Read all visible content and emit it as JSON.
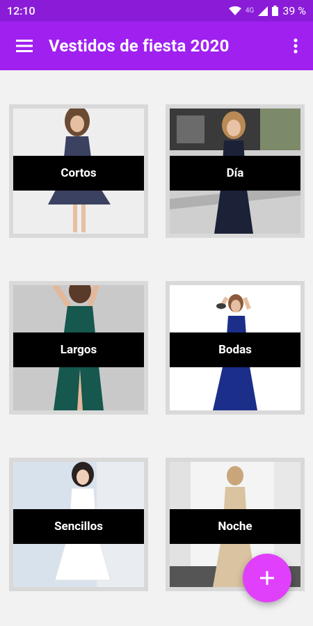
{
  "status_bar": {
    "time": "12:10",
    "network": "4G",
    "battery": "39 %"
  },
  "app_bar": {
    "title": "Vestidos de fiesta 2020",
    "menu_icon": "hamburger-menu-icon",
    "more_icon": "more-vert-icon"
  },
  "categories": [
    {
      "label": "Cortos"
    },
    {
      "label": "Día"
    },
    {
      "label": "Largos"
    },
    {
      "label": "Bodas"
    },
    {
      "label": "Sencillos"
    },
    {
      "label": "Noche"
    }
  ],
  "fab": {
    "icon": "plus-icon"
  },
  "colors": {
    "status_bar": "#8a1cd8",
    "app_bar": "#a020f0",
    "fab": "#e040fb",
    "label_band": "#000000"
  }
}
